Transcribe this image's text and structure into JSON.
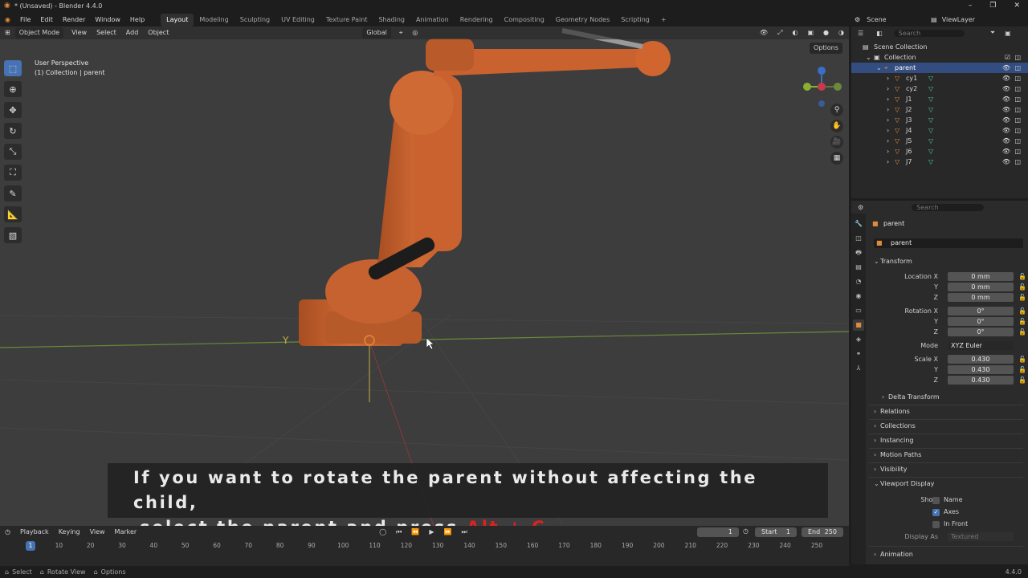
{
  "window": {
    "title": "* (Unsaved) - Blender 4.4.0",
    "controls": [
      "–",
      "❐",
      "✕"
    ]
  },
  "menu": [
    "File",
    "Edit",
    "Render",
    "Window",
    "Help"
  ],
  "workspaces": [
    "Layout",
    "Modeling",
    "Sculpting",
    "UV Editing",
    "Texture Paint",
    "Shading",
    "Animation",
    "Rendering",
    "Compositing",
    "Geometry Nodes",
    "Scripting",
    "+"
  ],
  "active_workspace": "Layout",
  "scene": {
    "scene_name": "Scene",
    "view_layer": "ViewLayer"
  },
  "viewport": {
    "mode": "Object Mode",
    "menus": [
      "View",
      "Select",
      "Add",
      "Object"
    ],
    "orientation": "Global",
    "options_label": "Options",
    "perspective": "User Perspective",
    "context": "(1) Collection | parent",
    "axis_label": "Y"
  },
  "subtitle": {
    "line1": "If you want to rotate the parent without affecting the child,",
    "line2_prefix": "select the parent and press",
    "line2_key": "Alt + C"
  },
  "outliner": {
    "search_placeholder": "Search",
    "scene_collection": "Scene Collection",
    "collection": "Collection",
    "parent": "parent",
    "children": [
      "cy1",
      "cy2",
      "J1",
      "J2",
      "J3",
      "J4",
      "J5",
      "J6",
      "J7"
    ]
  },
  "properties": {
    "search_placeholder": "Search",
    "object_name": "parent",
    "data_name": "parent",
    "transform_label": "Transform",
    "location_label": "Location X",
    "rotation_label": "Rotation X",
    "scale_label": "Scale X",
    "y": "Y",
    "z": "Z",
    "location": [
      "0 mm",
      "0 mm",
      "0 mm"
    ],
    "rotation": [
      "0°",
      "0°",
      "0°"
    ],
    "mode_label": "Mode",
    "mode_value": "XYZ Euler",
    "scale": [
      "0.430",
      "0.430",
      "0.430"
    ],
    "panels": [
      "Delta Transform",
      "Relations",
      "Collections",
      "Instancing",
      "Motion Paths",
      "Visibility",
      "Viewport Display"
    ],
    "show_label": "Show",
    "show_name": "Name",
    "show_axes": "Axes",
    "show_infront": "In Front",
    "display_as_label": "Display As",
    "display_as_value": "Textured",
    "animation_label": "Animation"
  },
  "timeline": {
    "menus": [
      "Playback",
      "Keying",
      "View",
      "Marker"
    ],
    "current_frame": "1",
    "start_label": "Start",
    "start": "1",
    "end_label": "End",
    "end": "250",
    "ticks": [
      "1",
      "10",
      "20",
      "30",
      "40",
      "50",
      "60",
      "70",
      "80",
      "90",
      "100",
      "110",
      "120",
      "130",
      "140",
      "150",
      "160",
      "170",
      "180",
      "190",
      "200",
      "210",
      "220",
      "230",
      "240",
      "250"
    ]
  },
  "status": {
    "select": "Select",
    "rotate": "Rotate View",
    "options": "Options",
    "version": "4.4.0"
  },
  "colors": {
    "accent": "#4772b3",
    "robot": "#c9622e",
    "selected_row": "#334d80",
    "highlight_text": "#e02020"
  }
}
